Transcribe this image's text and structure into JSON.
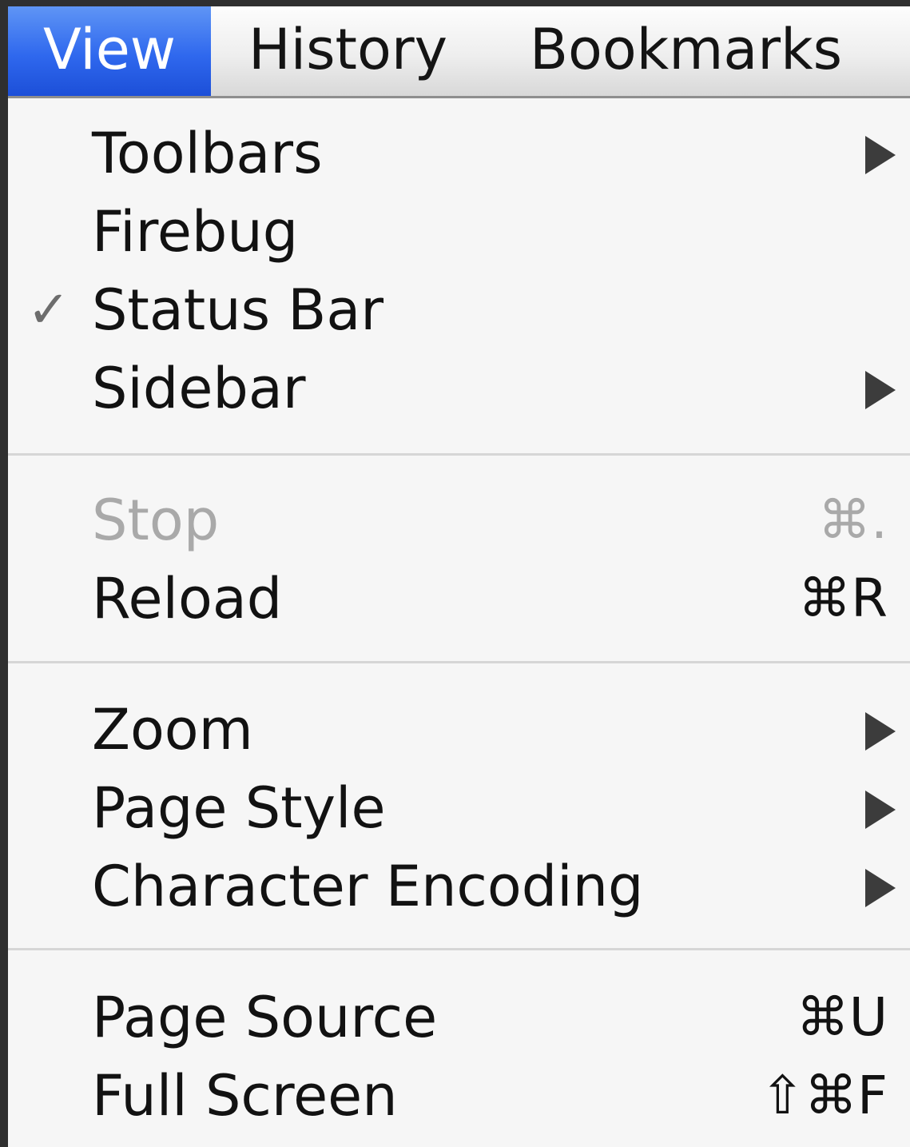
{
  "menubar": {
    "items": [
      {
        "label": "View",
        "active": true
      },
      {
        "label": "History",
        "active": false
      },
      {
        "label": "Bookmarks",
        "active": false
      }
    ]
  },
  "menu": {
    "toolbars": {
      "label": "Toolbars",
      "submenu": true
    },
    "firebug": {
      "label": "Firebug"
    },
    "status_bar": {
      "label": "Status Bar",
      "checked": true,
      "check": "✓"
    },
    "sidebar": {
      "label": "Sidebar",
      "submenu": true
    },
    "stop": {
      "label": "Stop",
      "shortcut": "⌘.",
      "enabled": false
    },
    "reload": {
      "label": "Reload",
      "shortcut": "⌘R"
    },
    "zoom": {
      "label": "Zoom",
      "submenu": true
    },
    "page_style": {
      "label": "Page Style",
      "submenu": true
    },
    "character_encoding": {
      "label": "Character Encoding",
      "submenu": true
    },
    "page_source": {
      "label": "Page Source",
      "shortcut": "⌘U"
    },
    "full_screen": {
      "label": "Full Screen",
      "shortcut": "⇧⌘F"
    }
  },
  "colors": {
    "highlight": "#2f68ee",
    "menu_background": "#f6f6f6",
    "disabled_text": "#a9a9a9"
  },
  "icons": {
    "check": "check-icon",
    "submenu": "submenu-arrow-icon"
  }
}
